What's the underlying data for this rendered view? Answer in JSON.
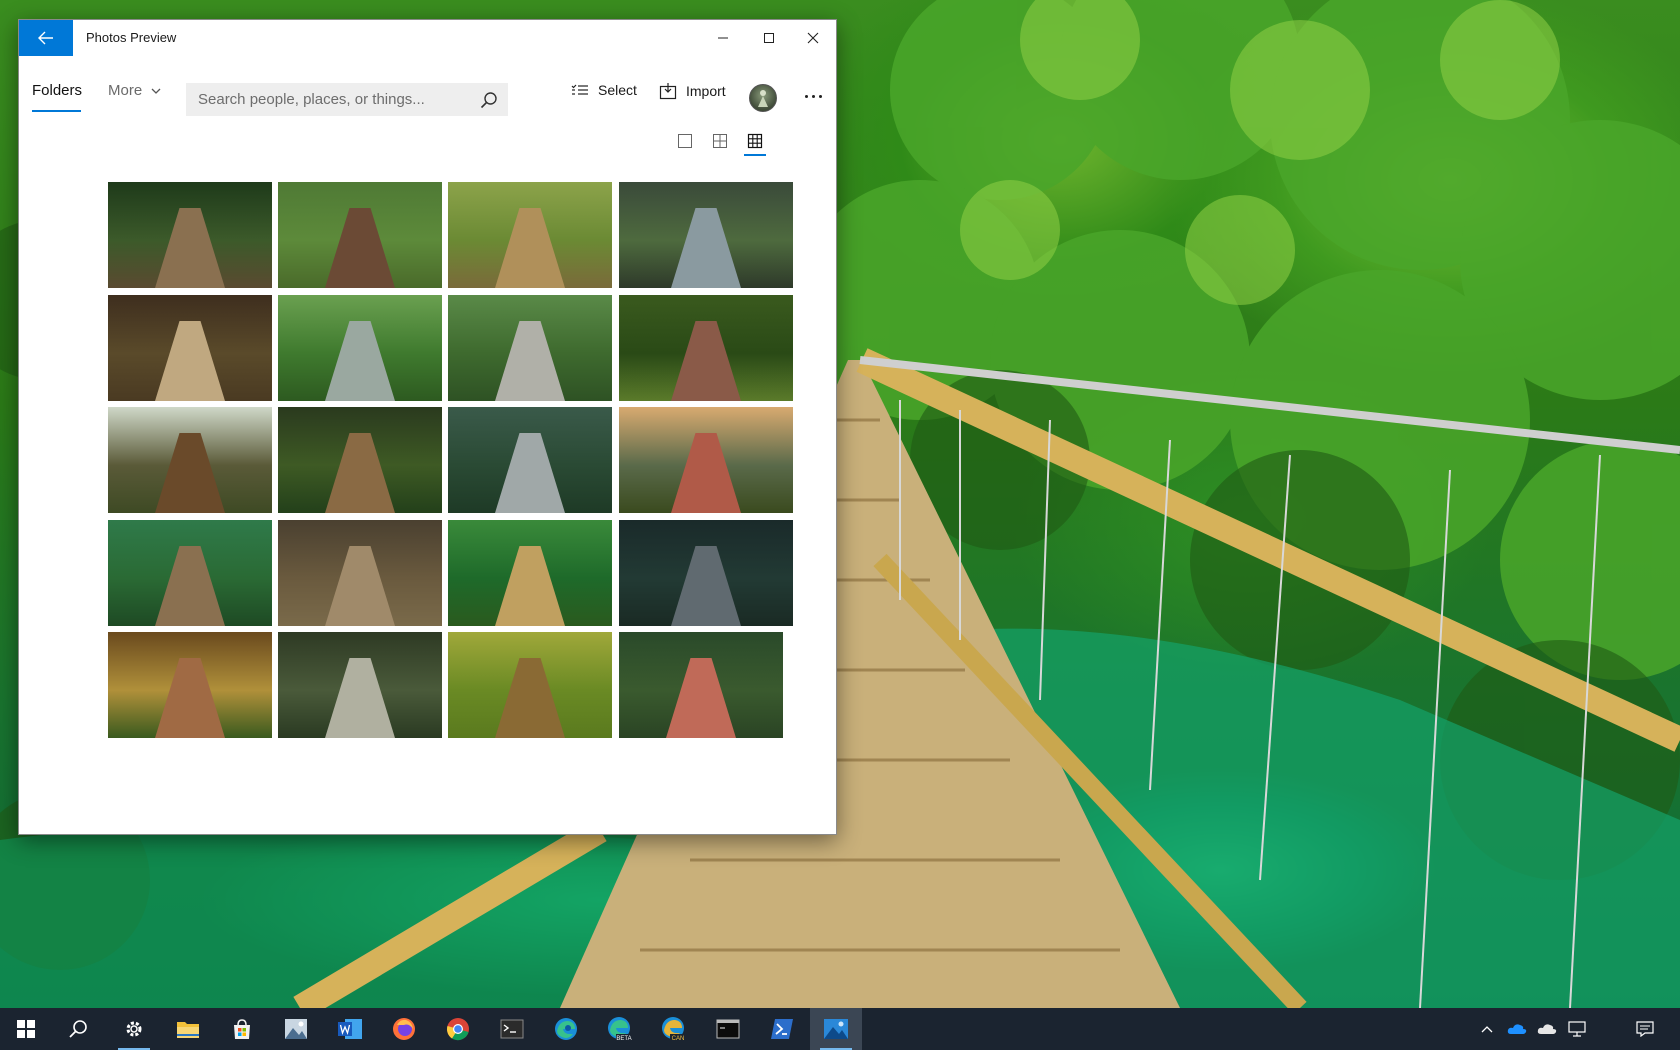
{
  "window": {
    "title": "Photos Preview",
    "controls": {
      "minimize": "minimize",
      "maximize": "maximize",
      "close": "close"
    }
  },
  "toolbar": {
    "tab_folders": "Folders",
    "more_label": "More",
    "search_placeholder": "Search people, places, or things...",
    "select_label": "Select",
    "import_label": "Import"
  },
  "view_modes": [
    "large",
    "medium",
    "small"
  ],
  "active_view": "small",
  "colors": {
    "accent": "#0078d7",
    "taskbar": "#1b2430"
  },
  "thumbnails": [
    {
      "sky": "#1e3a1a",
      "mid": "#3c5a2a",
      "ground": "#5a4a30",
      "path": "#8a7050"
    },
    {
      "sky": "#4f7a35",
      "mid": "#5d8a3a",
      "ground": "#4a6a2a",
      "path": "#6b4a35"
    },
    {
      "sky": "#8ca34a",
      "mid": "#6b8a34",
      "ground": "#7a6a3a",
      "path": "#b0905a"
    },
    {
      "sky": "#3a4a3a",
      "mid": "#4e6a3e",
      "ground": "#2e3a2a",
      "path": "#8a9aa0"
    },
    {
      "sky": "#3e2e1e",
      "mid": "#5a4a2a",
      "ground": "#4a3a22",
      "path": "#c0a880"
    },
    {
      "sky": "#6aa050",
      "mid": "#3f7a2e",
      "ground": "#2d5a20",
      "path": "#9aa8a0"
    },
    {
      "sky": "#5a8a48",
      "mid": "#3e6a2e",
      "ground": "#2e5224",
      "path": "#b0b0a8"
    },
    {
      "sky": "#3a5a1e",
      "mid": "#2a4a16",
      "ground": "#5a7a2a",
      "path": "#8a5a48"
    },
    {
      "sky": "#cfd8c8",
      "mid": "#5a5a38",
      "ground": "#3e4a24",
      "path": "#6a4a2a"
    },
    {
      "sky": "#2a3a1e",
      "mid": "#3e5a24",
      "ground": "#23401a",
      "path": "#8a6a44"
    },
    {
      "sky": "#3a5a4a",
      "mid": "#2a4a34",
      "ground": "#1e3a26",
      "path": "#a0a8a8"
    },
    {
      "sky": "#d8aa70",
      "mid": "#5a6a4a",
      "ground": "#3a4a1e",
      "path": "#b05a48"
    },
    {
      "sky": "#2f7a4a",
      "mid": "#2a6a34",
      "ground": "#1e4a24",
      "path": "#8a7050"
    },
    {
      "sky": "#4a4030",
      "mid": "#6a5a3e",
      "ground": "#7a6a4a",
      "path": "#a08a6a"
    },
    {
      "sky": "#3a8a3a",
      "mid": "#1e6a2a",
      "ground": "#2a5a1e",
      "path": "#c0a060"
    },
    {
      "sky": "#1a2a2a",
      "mid": "#223a34",
      "ground": "#1a2a24",
      "path": "#606a70"
    },
    {
      "sky": "#6a4a1e",
      "mid": "#b0903a",
      "ground": "#3a5a1e",
      "path": "#a06a44"
    },
    {
      "sky": "#2e3a24",
      "mid": "#4a5a3a",
      "ground": "#2a3a22",
      "path": "#b0b0a0"
    },
    {
      "sky": "#a0a83a",
      "mid": "#6a8a24",
      "ground": "#5a7a1e",
      "path": "#8a6a34"
    },
    {
      "sky": "#2a4a2a",
      "mid": "#3a5a2e",
      "ground": "#2a4424",
      "path": "#c06a58"
    }
  ],
  "taskbar": {
    "apps": [
      "start-icon",
      "search-icon",
      "settings-icon",
      "file-explorer-icon",
      "store-icon",
      "photos-app-icon",
      "word-icon",
      "firefox-icon",
      "chrome-icon",
      "terminal-icon",
      "edge-icon",
      "edge-beta-icon",
      "edge-canary-icon",
      "console-icon",
      "powershell-icon",
      "photos-preview-icon"
    ],
    "edge_beta_badge": "BETA",
    "edge_canary_badge": "CAN"
  }
}
